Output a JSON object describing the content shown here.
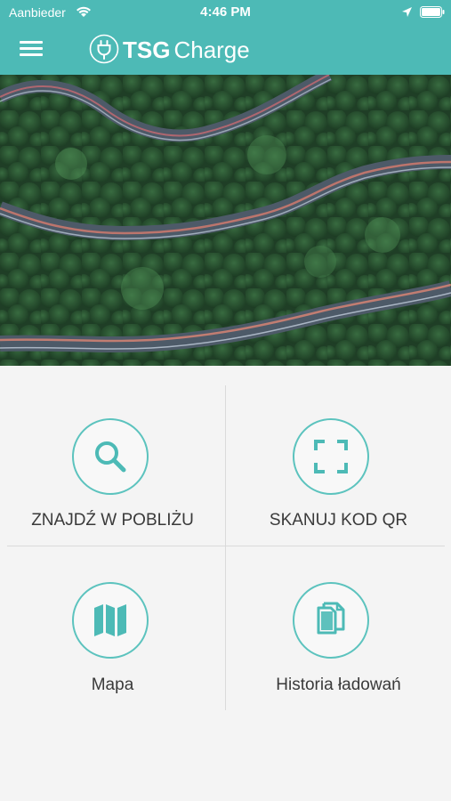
{
  "status_bar": {
    "carrier": "Aanbieder",
    "time": "4:46 PM"
  },
  "header": {
    "logo_bold": "TSG",
    "logo_light": "Charge",
    "accent_color": "#4dbab6"
  },
  "tiles": [
    {
      "label": "ZNAJDŹ W POBLIŻU",
      "icon": "search-icon"
    },
    {
      "label": "SKANUJ KOD QR",
      "icon": "qr-scan-icon"
    },
    {
      "label": "Mapa",
      "icon": "map-icon"
    },
    {
      "label": "Historia ładowań",
      "icon": "documents-icon"
    }
  ]
}
